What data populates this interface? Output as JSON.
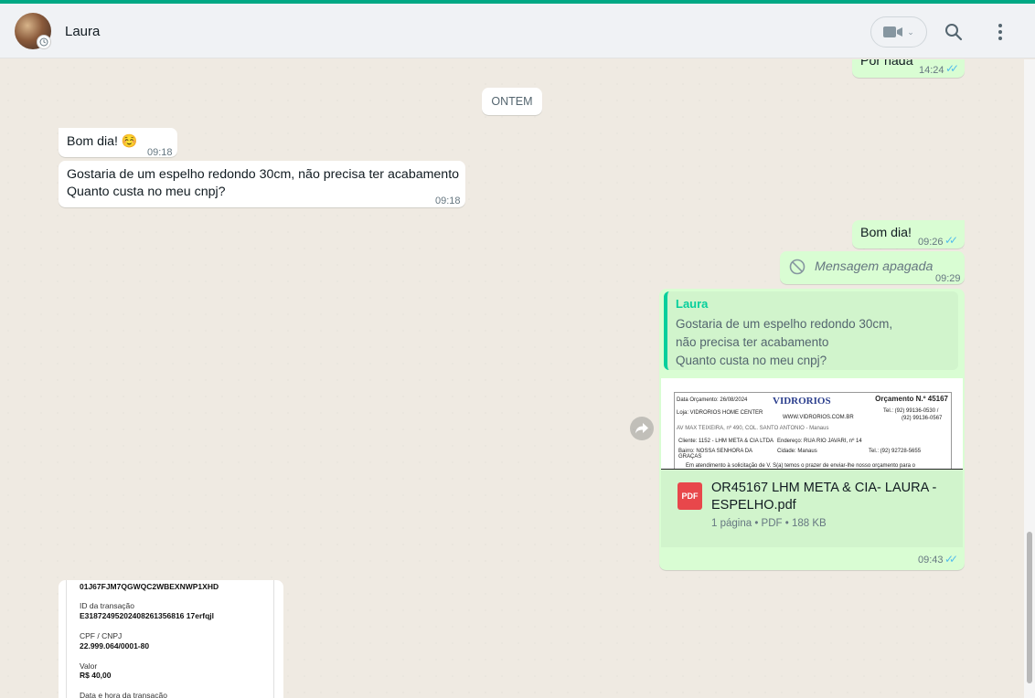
{
  "header": {
    "contact_name": "Laura",
    "icons": [
      "video-camera-icon",
      "chevron-down-icon",
      "search-icon",
      "menu-icon"
    ]
  },
  "messages": {
    "prev_out": {
      "text": "Por nada",
      "time": "14:24"
    },
    "date_chip": "ONTEM",
    "in_1": {
      "text": "Bom dia! ☺️",
      "time": "09:18"
    },
    "in_2": {
      "line1": "Gostaria de um espelho redondo 30cm, não precisa ter acabamento",
      "line2": "Quanto custa no meu cnpj?",
      "time": "09:18"
    },
    "out_1": {
      "text": "Bom dia!",
      "time": "09:26"
    },
    "out_deleted": {
      "text": "Mensagem apagada",
      "time": "09:29"
    },
    "reply": {
      "quote_author": "Laura",
      "quote_text": "Gostaria de um espelho redondo 30cm,\nnão precisa ter acabamento\nQuanto custa no meu cnpj?",
      "preview": {
        "date_label": "Data Orçamento: 26/08/2024",
        "logo": "VIDRORIOS",
        "title": "Orçamento N.º 45167",
        "store": "Loja: VIDRORIOS HOME CENTER",
        "site": "WWW.VIDRORIOS.COM.BR",
        "phone1": "Tel.: (92) 99136-0530 /",
        "phone2": "(92) 99136-0567",
        "address": "AV MAX TEIXEIRA, nº 490, COL. SANTO ANTONIO - Manaus",
        "client": "Cliente: 1152 - LHM META & CIA LTDA",
        "endereco": "Endereço: RUA RIO JAVARI, nº 14",
        "bairro": "Bairro: NOSSA SENHORA DA",
        "bairro2": "GRAÇAS",
        "cidade": "Cidade: Manaus",
        "tel": "Tel.: (92) 92728-5655",
        "note": "Em atendimento à solicitação de V. S(a) temos o prazer de enviar-lhe nosso orçamento para o"
      },
      "file_name": "OR45167 LHM META & CIA- LAURA - ESPELHO.pdf",
      "pdf_label": "PDF",
      "file_meta": "1 página • PDF • 188 KB",
      "time": "09:43"
    },
    "receipt": {
      "code": "01J67FJM7QGWQC2WBEXNWP1XHD",
      "id_label": "ID da transação",
      "id_value": "E31872495202408261356816 17erfqjl",
      "cpf_label": "CPF / CNPJ",
      "cpf_value": "22.999.064/0001-80",
      "valor_label": "Valor",
      "valor_value": "R$ 40,00",
      "data_label": "Data e hora da transação"
    }
  },
  "colors": {
    "accent": "#00a884",
    "out_bubble": "#d9fdd3",
    "in_bubble": "#ffffff",
    "ticks": "#53bdeb"
  }
}
